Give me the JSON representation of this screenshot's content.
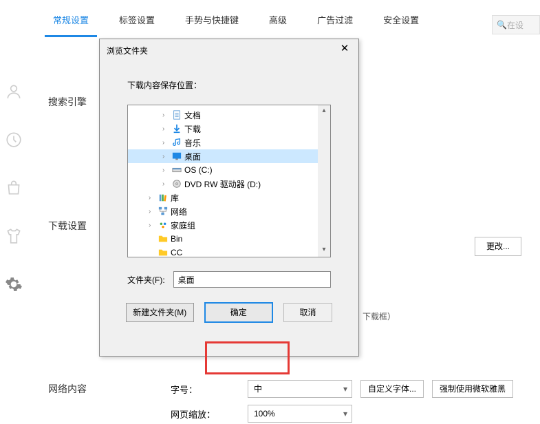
{
  "tabs": {
    "items": [
      {
        "label": "常规设置",
        "active": true
      },
      {
        "label": "标签设置"
      },
      {
        "label": "手势与快捷键"
      },
      {
        "label": "高级"
      },
      {
        "label": "广告过滤"
      },
      {
        "label": "安全设置"
      }
    ]
  },
  "search": {
    "placeholder": "在设"
  },
  "sections": {
    "search_engine": "搜索引擎",
    "download_settings": "下载设置",
    "network_content": "网络内容"
  },
  "change_button": "更改...",
  "download_frame_hint": "下载框）",
  "network": {
    "font_size_label": "字号：",
    "font_size_value": "中",
    "zoom_label": "网页缩放：",
    "zoom_value": "100%",
    "custom_font_btn": "自定义字体...",
    "force_font_btn": "强制使用微软雅黑"
  },
  "dialog": {
    "title": "浏览文件夹",
    "subtitle": "下载内容保存位置：",
    "tree": [
      {
        "caret": "›",
        "icon": "document",
        "label": "文档",
        "level": 2
      },
      {
        "caret": "›",
        "icon": "download-arrow",
        "label": "下载",
        "level": 2
      },
      {
        "caret": "›",
        "icon": "music",
        "label": "音乐",
        "level": 2
      },
      {
        "caret": "›",
        "icon": "desktop",
        "label": "桌面",
        "level": 2,
        "selected": true
      },
      {
        "caret": "›",
        "icon": "drive",
        "label": "OS (C:)",
        "level": 2
      },
      {
        "caret": "›",
        "icon": "dvd",
        "label": "DVD RW 驱动器 (D:)",
        "level": 2
      },
      {
        "caret": "›",
        "icon": "library",
        "label": "库",
        "level": 1
      },
      {
        "caret": "›",
        "icon": "network",
        "label": "网络",
        "level": 1
      },
      {
        "caret": "›",
        "icon": "homegroup",
        "label": "家庭组",
        "level": 1
      },
      {
        "caret": "",
        "icon": "folder",
        "label": "Bin",
        "level": 1
      },
      {
        "caret": "",
        "icon": "folder",
        "label": "CC",
        "level": 1
      }
    ],
    "folder_label": "文件夹(F):",
    "folder_value": "桌面",
    "new_folder_btn": "新建文件夹(M)",
    "ok_btn": "确定",
    "cancel_btn": "取消"
  }
}
